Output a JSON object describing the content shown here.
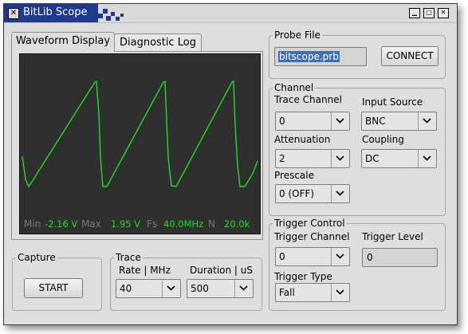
{
  "window": {
    "title": "BitLib Scope",
    "icon": "x-icon"
  },
  "tabs": [
    {
      "label": "Waveform Display"
    },
    {
      "label": "Diagnostic Log"
    }
  ],
  "scope": {
    "trace_color": "#22dd22",
    "background": "#2f2f2f",
    "stats": {
      "min_label": "Min",
      "min_value": "-2.16 V",
      "max_label": "Max",
      "max_value": "1.95 V",
      "fs_label": "Fs",
      "fs_value": "40.0MHz",
      "n_label": "N",
      "n_value": "20.0k"
    }
  },
  "capture": {
    "legend": "Capture",
    "start_label": "START"
  },
  "trace": {
    "legend": "Trace",
    "rate_label": "Rate | MHz",
    "rate_value": "40",
    "duration_label": "Duration | uS",
    "duration_value": "500"
  },
  "probe_file": {
    "legend": "Probe File",
    "filename": "bitscope.prb",
    "connect_label": "CONNECT"
  },
  "channel": {
    "legend": "Channel",
    "trace_channel_label": "Trace Channel",
    "trace_channel_value": "0",
    "input_source_label": "Input Source",
    "input_source_value": "BNC",
    "attenuation_label": "Attenuation",
    "attenuation_value": "2",
    "coupling_label": "Coupling",
    "coupling_value": "DC",
    "prescale_label": "Prescale",
    "prescale_value": "0 (OFF)"
  },
  "trigger": {
    "legend": "Trigger Control",
    "channel_label": "Trigger Channel",
    "channel_value": "0",
    "level_label": "Trigger Level",
    "level_value": "0",
    "type_label": "Trigger Type",
    "type_value": "Fall"
  }
}
